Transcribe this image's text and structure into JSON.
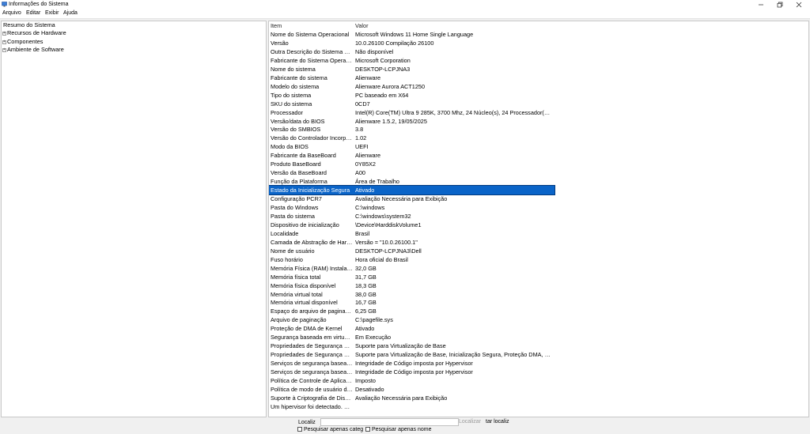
{
  "window": {
    "title": "Informações do Sistema"
  },
  "menu": [
    "Arquivo",
    "Editar",
    "Exibir",
    "Ajuda"
  ],
  "tree": {
    "root": "Resumo do Sistema",
    "children": [
      "Recursos de Hardware",
      "Componentes",
      "Ambiente de Software"
    ]
  },
  "table": {
    "headers": {
      "item": "Item",
      "value": "Valor"
    },
    "selected_index": 19,
    "rows": [
      {
        "item": "Nome do Sistema Operacional",
        "value": "Microsoft Windows 11 Home Single Language"
      },
      {
        "item": "Versão",
        "value": "10.0.26100 Compilação 26100"
      },
      {
        "item": "Outra Descrição do Sistema Op...",
        "value": "Não disponível"
      },
      {
        "item": "Fabricante do Sistema Operaci...",
        "value": "Microsoft Corporation"
      },
      {
        "item": "Nome do sistema",
        "value": "DESKTOP-LCPJNA3"
      },
      {
        "item": "Fabricante do sistema",
        "value": "Alienware"
      },
      {
        "item": "Modelo do sistema",
        "value": "Alienware Aurora ACT1250"
      },
      {
        "item": "Tipo do sistema",
        "value": "PC baseado em X64"
      },
      {
        "item": "SKU do sistema",
        "value": "0CD7"
      },
      {
        "item": "Processador",
        "value": "Intel(R) Core(TM) Ultra 9 285K, 3700 Mhz, 24 Núcleo(s), 24 Processador(es) Ló..."
      },
      {
        "item": "Versão/data do BIOS",
        "value": "Alienware 1.5.2, 19/05/2025"
      },
      {
        "item": "Versão do SMBIOS",
        "value": "3.8"
      },
      {
        "item": "Versão do Controlador Incorpo...",
        "value": "1.02"
      },
      {
        "item": "Modo da BIOS",
        "value": "UEFI"
      },
      {
        "item": "Fabricante da BaseBoard",
        "value": "Alienware"
      },
      {
        "item": "Produto BaseBoard",
        "value": "0Y85X2"
      },
      {
        "item": "Versão da BaseBoard",
        "value": "A00"
      },
      {
        "item": "Função da Plataforma",
        "value": "Área de Trabalho"
      },
      {
        "item": "Estado da Inicialização Segura",
        "value": "Ativado"
      },
      {
        "item": "Configuração PCR7",
        "value": "Avaliação Necessária para Exibição"
      },
      {
        "item": "Pasta do Windows",
        "value": "C:\\windows"
      },
      {
        "item": "Pasta do sistema",
        "value": "C:\\windows\\system32"
      },
      {
        "item": "Dispositivo de inicialização",
        "value": "\\Device\\HarddiskVolume1"
      },
      {
        "item": "Localidade",
        "value": "Brasil"
      },
      {
        "item": "Camada de Abstração de Hard...",
        "value": "Versão = \"10.0.26100.1\""
      },
      {
        "item": "Nome de usuário",
        "value": "DESKTOP-LCPJNA3\\Dell"
      },
      {
        "item": "Fuso horário",
        "value": "Hora oficial do Brasil"
      },
      {
        "item": "Memória Física (RAM) Instalada",
        "value": "32,0 GB"
      },
      {
        "item": "Memória física total",
        "value": "31,7 GB"
      },
      {
        "item": "Memória física disponível",
        "value": "18,3 GB"
      },
      {
        "item": "Memória virtual total",
        "value": "38,0 GB"
      },
      {
        "item": "Memória virtual disponível",
        "value": "16,7 GB"
      },
      {
        "item": "Espaço do arquivo de paginação",
        "value": "6,25 GB"
      },
      {
        "item": "Arquivo de paginação",
        "value": "C:\\pagefile.sys"
      },
      {
        "item": "Proteção de DMA de Kernel",
        "value": "Ativado"
      },
      {
        "item": "Segurança baseada em virtualiz...",
        "value": "Em Execução"
      },
      {
        "item": "Propriedades de Segurança Ob...",
        "value": "Suporte para Virtualização de Base"
      },
      {
        "item": "Propriedades de Segurança Dis...",
        "value": "Suporte para Virtualização de Base, Inicialização Segura, Proteção DMA, Códi..."
      },
      {
        "item": "Serviços de segurança baseada ...",
        "value": "Integridade de Código imposta por Hypervisor"
      },
      {
        "item": "Serviços de segurança baseada ...",
        "value": "Integridade de Código imposta por Hypervisor"
      },
      {
        "item": "Política de Controle de Aplicati...",
        "value": "Imposto"
      },
      {
        "item": "Política de modo de usuário do...",
        "value": "Desativado"
      },
      {
        "item": "Suporte à Criptografia de Disp...",
        "value": "Avaliação Necessária para Exibição"
      },
      {
        "item": "Um hipervisor foi detectado. Re...",
        "value": ""
      }
    ]
  },
  "find": {
    "label": "Localiz",
    "input_value": "",
    "find_button": "Localizar",
    "close_button": "tar localiz",
    "check_selected": "Pesquisar apenas categ",
    "check_names": "Pesquisar apenas nome"
  },
  "colors": {
    "selection": "#0a64c8",
    "window_bg": "#f0f0f0"
  }
}
